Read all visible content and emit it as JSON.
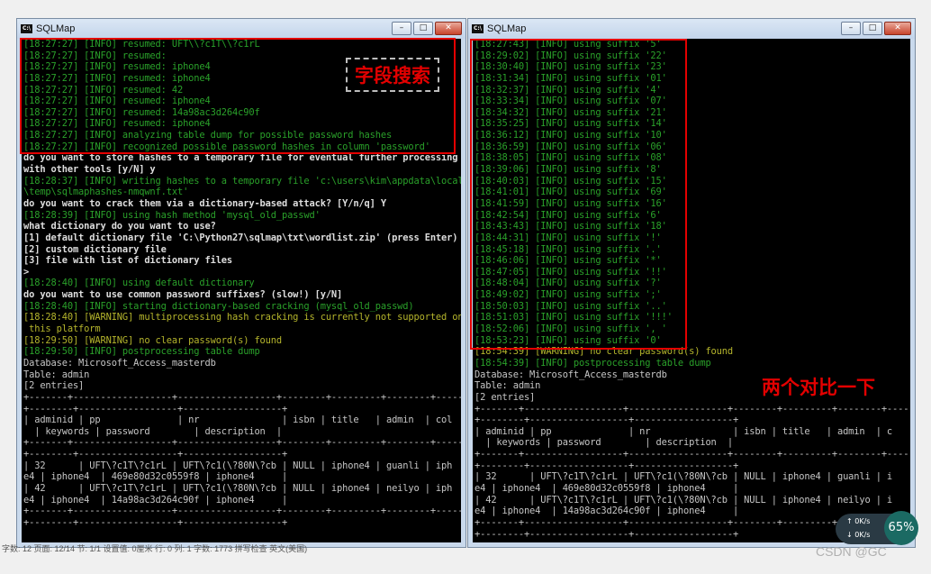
{
  "left_window": {
    "title": "SQLMap",
    "icon_text": "C:\\",
    "lines": [
      {
        "t": "[18:27:27] [INFO] resumed: UFT\\\\?c1T\\\\?c1rL",
        "c": "g"
      },
      {
        "t": "[18:27:27] [INFO] resumed:",
        "c": "g"
      },
      {
        "t": "[18:27:27] [INFO] resumed: iphone4",
        "c": "g"
      },
      {
        "t": "[18:27:27] [INFO] resumed: iphone4",
        "c": "g"
      },
      {
        "t": "[18:27:27] [INFO] resumed: 42",
        "c": "g"
      },
      {
        "t": "[18:27:27] [INFO] resumed: iphone4",
        "c": "g"
      },
      {
        "t": "[18:27:27] [INFO] resumed: 14a98ac3d264c90f",
        "c": "g"
      },
      {
        "t": "[18:27:27] [INFO] resumed: iphone4",
        "c": "g"
      },
      {
        "t": "[18:27:27] [INFO] analyzing table dump for possible password hashes",
        "c": "g"
      },
      {
        "t": "[18:27:27] [INFO] recognized possible password hashes in column 'password'",
        "c": "g"
      },
      {
        "t": "do you want to store hashes to a temporary file for eventual further processing",
        "c": "w"
      },
      {
        "t": "with other tools [y/N] y",
        "c": "w"
      },
      {
        "t": "[18:28:37] [INFO] writing hashes to a temporary file 'c:\\users\\kim\\appdata\\local",
        "c": "g"
      },
      {
        "t": "\\temp\\sqlmaphashes-nmqwnf.txt'",
        "c": "g"
      },
      {
        "t": "do you want to crack them via a dictionary-based attack? [Y/n/q] Y",
        "c": "w"
      },
      {
        "t": "[18:28:39] [INFO] using hash method 'mysql_old_passwd'",
        "c": "g"
      },
      {
        "t": "what dictionary do you want to use?",
        "c": "w"
      },
      {
        "t": "[1] default dictionary file 'C:\\Python27\\sqlmap\\txt\\wordlist.zip' (press Enter)",
        "c": "w"
      },
      {
        "t": "[2] custom dictionary file",
        "c": "w"
      },
      {
        "t": "[3] file with list of dictionary files",
        "c": "w"
      },
      {
        "t": ">",
        "c": "w"
      },
      {
        "t": "[18:28:40] [INFO] using default dictionary",
        "c": "g"
      },
      {
        "t": "do you want to use common password suffixes? (slow!) [y/N]",
        "c": "w"
      },
      {
        "t": "[18:28:40] [INFO] starting dictionary-based cracking (mysql_old_passwd)",
        "c": "g"
      },
      {
        "t": "[18:28:40] [WARNING] multiprocessing hash cracking is currently not supported on",
        "c": "y"
      },
      {
        "t": " this platform",
        "c": "y"
      },
      {
        "t": "[18:29:50] [WARNING] no clear password(s) found",
        "c": "y"
      },
      {
        "t": "[18:29:50] [INFO] postprocessing table dump",
        "c": "g"
      },
      {
        "t": "Database: Microsoft_Access_masterdb",
        "c": "n"
      },
      {
        "t": "Table: admin",
        "c": "n"
      },
      {
        "t": "[2 entries]",
        "c": "n"
      },
      {
        "t": "+-------+------------------+------------------+--------+---------+--------+------",
        "c": "n"
      },
      {
        "t": "+--------+------------------+------------------+",
        "c": "n"
      },
      {
        "t": "| adminid | pp              | nr               | isbn | title   | admin  | col",
        "c": "n"
      },
      {
        "t": "  | keywords | password        | description  |",
        "c": "n"
      },
      {
        "t": "+-------+------------------+------------------+--------+---------+--------+------",
        "c": "n"
      },
      {
        "t": "+--------+------------------+------------------+",
        "c": "n"
      },
      {
        "t": "| 32      | UFT\\?c1T\\?c1rL | UFT\\?c1(\\?80N\\?cb | NULL | iphone4 | guanli | iph",
        "c": "n"
      },
      {
        "t": "e4 | iphone4  | 469e80d32c0559f8 | iphone4     |",
        "c": "n"
      },
      {
        "t": "| 42      | UFT\\?c1T\\?c1rL | UFT\\?c1(\\?80N\\?cb | NULL | iphone4 | neilyo | iph",
        "c": "n"
      },
      {
        "t": "e4 | iphone4  | 14a98ac3d264c90f | iphone4     |",
        "c": "n"
      },
      {
        "t": "+-------+------------------+------------------+--------+---------+--------+------",
        "c": "n"
      },
      {
        "t": "+--------+------------------+------------------+",
        "c": "n"
      }
    ],
    "annotation": "字段搜索"
  },
  "right_window": {
    "title": "SQLMap",
    "icon_text": "C:\\",
    "lines": [
      {
        "t": "[18:27:43] [INFO] using suffix '5'",
        "c": "g"
      },
      {
        "t": "[18:29:02] [INFO] using suffix '22'",
        "c": "g"
      },
      {
        "t": "[18:30:40] [INFO] using suffix '23'",
        "c": "g"
      },
      {
        "t": "[18:31:34] [INFO] using suffix '01'",
        "c": "g"
      },
      {
        "t": "[18:32:37] [INFO] using suffix '4'",
        "c": "g"
      },
      {
        "t": "[18:33:34] [INFO] using suffix '07'",
        "c": "g"
      },
      {
        "t": "[18:34:32] [INFO] using suffix '21'",
        "c": "g"
      },
      {
        "t": "[18:35:25] [INFO] using suffix '14'",
        "c": "g"
      },
      {
        "t": "[18:36:12] [INFO] using suffix '10'",
        "c": "g"
      },
      {
        "t": "[18:36:59] [INFO] using suffix '06'",
        "c": "g"
      },
      {
        "t": "[18:38:05] [INFO] using suffix '08'",
        "c": "g"
      },
      {
        "t": "[18:39:06] [INFO] using suffix '8'",
        "c": "g"
      },
      {
        "t": "[18:40:03] [INFO] using suffix '15'",
        "c": "g"
      },
      {
        "t": "[18:41:01] [INFO] using suffix '69'",
        "c": "g"
      },
      {
        "t": "[18:41:59] [INFO] using suffix '16'",
        "c": "g"
      },
      {
        "t": "[18:42:54] [INFO] using suffix '6'",
        "c": "g"
      },
      {
        "t": "[18:43:43] [INFO] using suffix '18'",
        "c": "g"
      },
      {
        "t": "[18:44:31] [INFO] using suffix '!'",
        "c": "g"
      },
      {
        "t": "[18:45:18] [INFO] using suffix '.'",
        "c": "g"
      },
      {
        "t": "[18:46:06] [INFO] using suffix '*'",
        "c": "g"
      },
      {
        "t": "[18:47:05] [INFO] using suffix '!!'",
        "c": "g"
      },
      {
        "t": "[18:48:04] [INFO] using suffix '?'",
        "c": "g"
      },
      {
        "t": "[18:49:02] [INFO] using suffix ';'",
        "c": "g"
      },
      {
        "t": "[18:50:03] [INFO] using suffix '..'",
        "c": "g"
      },
      {
        "t": "[18:51:03] [INFO] using suffix '!!!'",
        "c": "g"
      },
      {
        "t": "[18:52:06] [INFO] using suffix ', '",
        "c": "g"
      },
      {
        "t": "[18:53:23] [INFO] using suffix '0'",
        "c": "g"
      },
      {
        "t": "[18:54:39] [WARNING] no clear password(s) found",
        "c": "y"
      },
      {
        "t": "[18:54:39] [INFO] postprocessing table dump",
        "c": "g"
      },
      {
        "t": "Database: Microsoft_Access_masterdb",
        "c": "n"
      },
      {
        "t": "Table: admin",
        "c": "n"
      },
      {
        "t": "[2 entries]",
        "c": "n"
      },
      {
        "t": "+-------+------------------+------------------+--------+---------+--------+------",
        "c": "n"
      },
      {
        "t": "+--------+------------------+------------------+",
        "c": "n"
      },
      {
        "t": "| adminid | pp              | nr               | isbn | title   | admin  | c",
        "c": "n"
      },
      {
        "t": "  | keywords | password        | description  |",
        "c": "n"
      },
      {
        "t": "+-------+------------------+------------------+--------+---------+--------+------",
        "c": "n"
      },
      {
        "t": "+--------+------------------+------------------+",
        "c": "n"
      },
      {
        "t": "| 32      | UFT\\?c1T\\?c1rL | UFT\\?c1(\\?80N\\?cb | NULL | iphone4 | guanli | i",
        "c": "n"
      },
      {
        "t": "e4 | iphone4  | 469e80d32c0559f8 | iphone4     |",
        "c": "n"
      },
      {
        "t": "| 42      | UFT\\?c1T\\?c1rL | UFT\\?c1(\\?80N\\?cb | NULL | iphone4 | neilyo | i",
        "c": "n"
      },
      {
        "t": "e4 | iphone4  | 14a98ac3d264c90f | iphone4     |",
        "c": "n"
      },
      {
        "t": "+-------+------------------+------------------+--------+---------+--------+------",
        "c": "n"
      },
      {
        "t": "+--------+------------------+------------------+",
        "c": "n"
      }
    ],
    "annotation": "两个对比一下"
  },
  "controls": {
    "minimize": "–",
    "maximize": "□",
    "close": "✕"
  },
  "status_bar": "字数: 12    页面: 12/14    节: 1/1    设置值: 0厘米    行: 0    列: 1    字数: 1773    拼写检查    英文(美国)",
  "network_widget": {
    "up": "0K/s",
    "down": "0K/s",
    "percent": "65%"
  },
  "watermark": "CSDN @GC​",
  "colors": {
    "annotation_red": "#e30000",
    "console_green": "#2aa12a",
    "console_yellow": "#b5b52c",
    "console_bg": "#000000"
  }
}
